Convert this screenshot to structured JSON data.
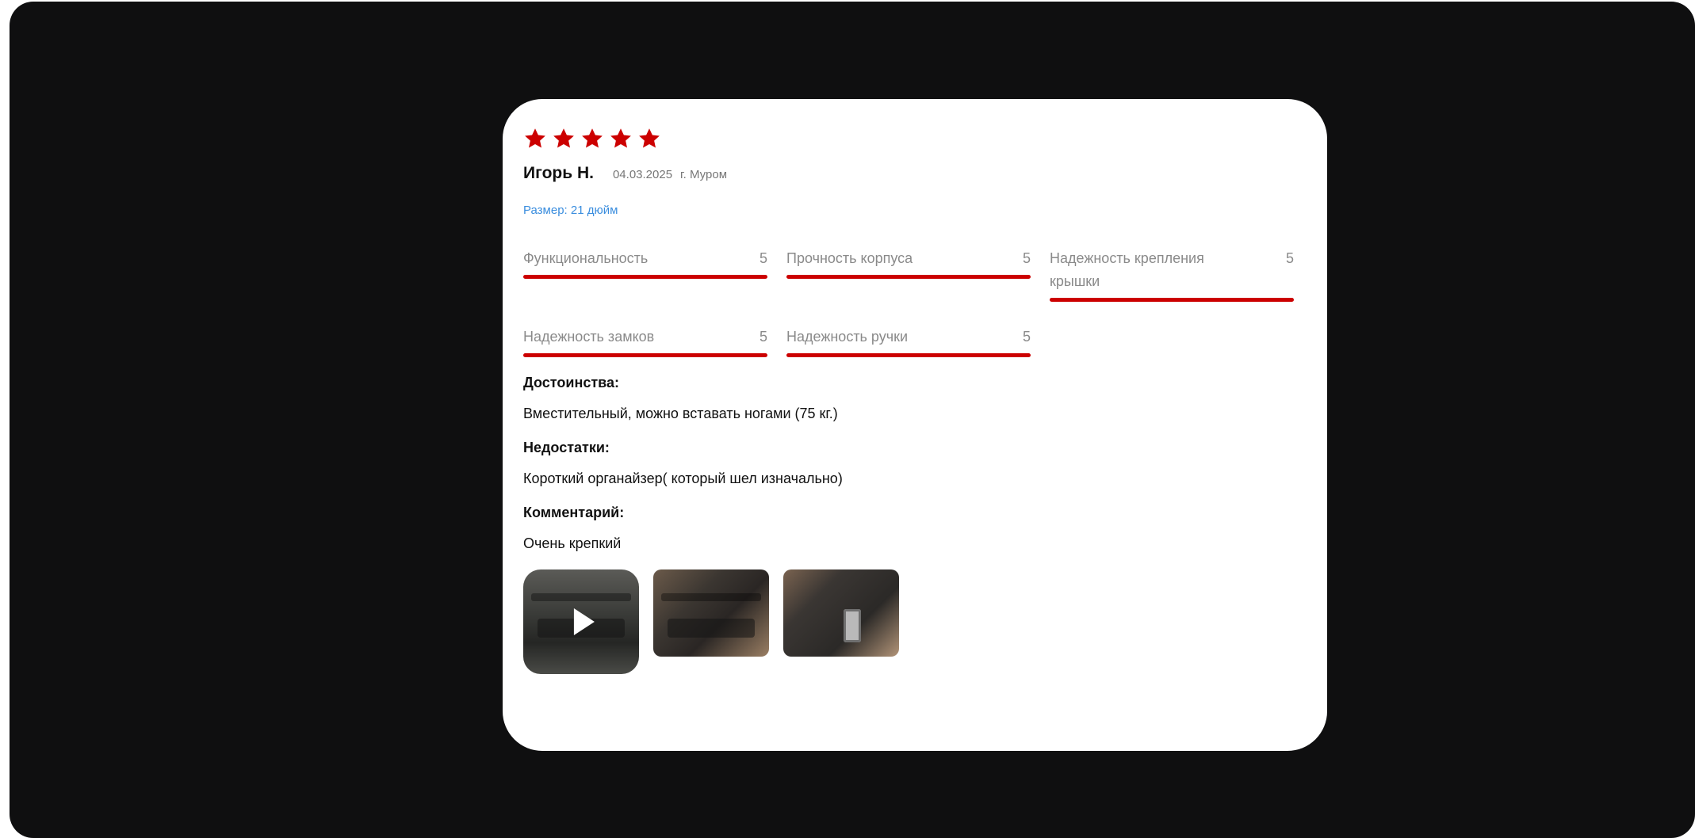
{
  "review": {
    "rating": 5,
    "stars": [
      1,
      2,
      3,
      4,
      5
    ],
    "author": "Игорь Н.",
    "date": "04.03.2025",
    "city": "г. Муром",
    "size": "Размер: 21 дюйм",
    "ratings": [
      {
        "label": "Функциональность",
        "value": "5",
        "fraction": 1.0
      },
      {
        "label": "Прочность корпуса",
        "value": "5",
        "fraction": 1.0
      },
      {
        "label": "Надежность крепления крышки",
        "value": "5",
        "fraction": 1.0
      },
      {
        "label": "Надежность замков",
        "value": "5",
        "fraction": 1.0
      },
      {
        "label": "Надежность ручки",
        "value": "5",
        "fraction": 1.0
      }
    ],
    "advantages_title": "Достоинства:",
    "advantages_text": "Вместительный, можно вставать ногами (75 кг.)",
    "disadvantages_title": "Недостатки:",
    "disadvantages_text": "Короткий органайзер( который шел изначально)",
    "comment_title": "Комментарий:",
    "comment_text": "Очень крепкий",
    "media": [
      {
        "type": "video",
        "icon": "play-icon"
      },
      {
        "type": "photo"
      },
      {
        "type": "photo"
      }
    ]
  },
  "colors": {
    "accent": "#cc0000",
    "link": "#3a8dde",
    "background": "#0f0f10",
    "card": "#ffffff"
  }
}
